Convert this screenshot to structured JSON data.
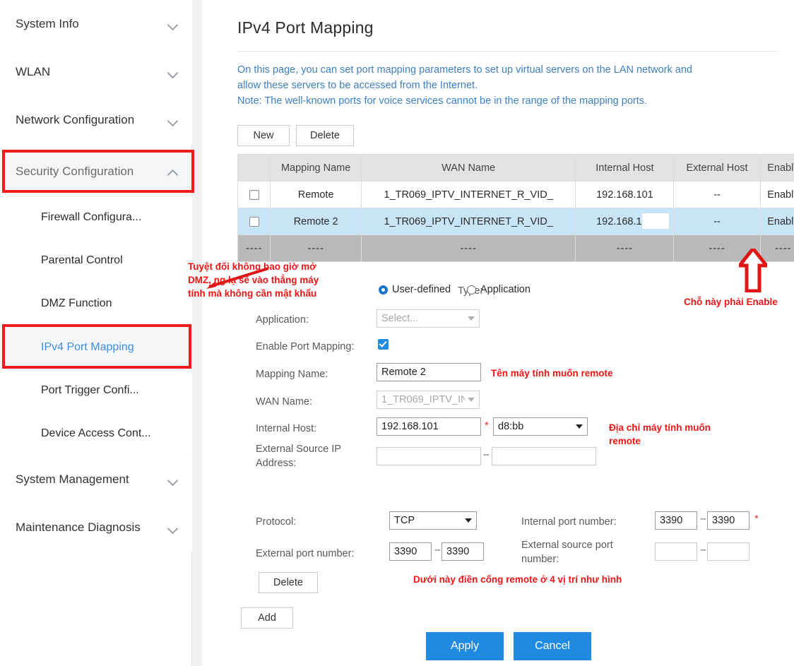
{
  "sidebar": {
    "top_items": [
      {
        "label": "System Info",
        "chevron": "chevron-down-icon"
      },
      {
        "label": "WLAN",
        "chevron": "chevron-down-icon"
      },
      {
        "label": "Network Configuration",
        "chevron": "chevron-down-icon"
      },
      {
        "label": "Security Configuration",
        "chevron": "chevron-up-icon"
      }
    ],
    "sub_items": [
      {
        "label": "Firewall Configura..."
      },
      {
        "label": "Parental Control"
      },
      {
        "label": "DMZ Function"
      },
      {
        "label": "IPv4 Port Mapping"
      },
      {
        "label": "Port Trigger Confi..."
      },
      {
        "label": "Device Access Cont..."
      }
    ],
    "bottom_items": [
      {
        "label": "System Management",
        "chevron": "chevron-down-icon"
      },
      {
        "label": "Maintenance Diagnosis",
        "chevron": "chevron-down-icon"
      }
    ]
  },
  "page": {
    "title": "IPv4 Port Mapping",
    "description_line1": "On this page, you can set port mapping parameters to set up virtual servers on the LAN network and",
    "description_line2": "allow these servers to be accessed from the Internet.",
    "description_line3": "Note: The well-known ports for voice services cannot be in the range of the mapping ports."
  },
  "toolbar": {
    "new_label": "New",
    "delete_label": "Delete"
  },
  "table": {
    "headers": [
      "",
      "Mapping Name",
      "WAN Name",
      "Internal Host",
      "External Host",
      "Enable"
    ],
    "rows": [
      {
        "mapping_name": "Remote",
        "wan_name": "1_TR069_IPTV_INTERNET_R_VID_",
        "internal_host": "192.168.101",
        "external_host": "--",
        "enable": "Enable"
      },
      {
        "mapping_name": "Remote 2",
        "wan_name": "1_TR069_IPTV_INTERNET_R_VID_",
        "internal_host": "192.168.101",
        "external_host": "--",
        "enable": "Enable"
      }
    ],
    "footer_row": [
      "----",
      "----",
      "----",
      "----",
      "----",
      "----"
    ]
  },
  "form": {
    "type_label": "Type:",
    "radio_user_defined": "User-defined",
    "radio_application": "Application",
    "application_label": "Application:",
    "application_value": "Select...",
    "enable_port_mapping_label": "Enable Port Mapping:",
    "mapping_name_label": "Mapping Name:",
    "mapping_name_value": "Remote 2",
    "wan_name_label": "WAN Name:",
    "wan_name_value": "1_TR069_IPTV_IN",
    "internal_host_label": "Internal Host:",
    "internal_host_value": "192.168.101",
    "internal_host_required": "*",
    "internal_host_mac_value": "d8:bb",
    "external_source_ip_label": "External Source IP Address:",
    "external_source_ip_from": "",
    "external_source_ip_to": "",
    "range_separator": "--",
    "protocol_label": "Protocol:",
    "protocol_value": "TCP",
    "external_port_label": "External port number:",
    "external_port_from": "3390",
    "external_port_to": "3390",
    "internal_port_label": "Internal port number:",
    "internal_port_from": "3390",
    "internal_port_to": "3390",
    "internal_port_required": "*",
    "external_source_port_label": "External source port number:",
    "external_source_port_from": "",
    "external_source_port_to": "",
    "delete_label": "Delete",
    "add_label": "Add",
    "apply_label": "Apply",
    "cancel_label": "Cancel"
  },
  "annotations": {
    "dmz_warning": "Tuyệt đối không bao giờ mở DMZ, ng lạ sẽ vào thẳng máy tính mà không cần mật khẩu",
    "must_enable": "Chỗ này phải Enable",
    "mapping_name_hint": "Tên máy tính muốn remote",
    "internal_host_hint": "Địa chỉ máy tính muốn remote",
    "ports_hint": "Dưới này điền cổng remote ở 4 vị trí như hình"
  },
  "colors": {
    "annotation_red": "#f21414",
    "highlight_red": "#ef1c1c",
    "link_blue": "#3d7fc1",
    "accent_blue": "#1f8ae0",
    "selected_row": "#c7e5f7"
  }
}
